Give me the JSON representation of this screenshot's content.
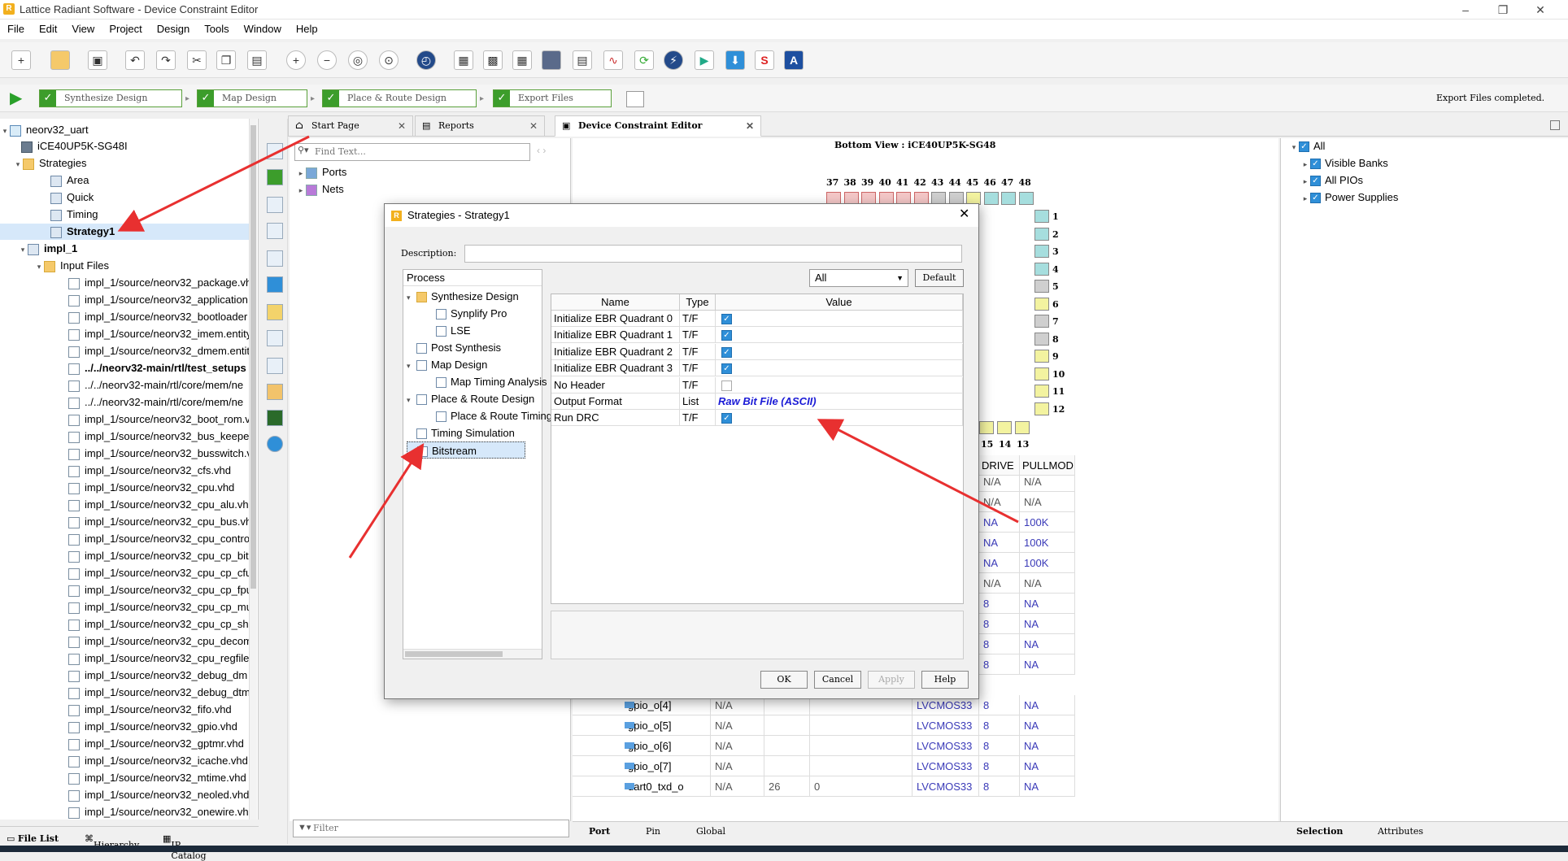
{
  "window": {
    "title": "Lattice Radiant Software - Device Constraint Editor",
    "minimize": "–",
    "maximize": "❐",
    "close": "✕"
  },
  "menu": [
    "File",
    "Edit",
    "View",
    "Project",
    "Design",
    "Tools",
    "Window",
    "Help"
  ],
  "flow": {
    "steps": [
      "Synthesize Design",
      "Map Design",
      "Place & Route Design",
      "Export Files"
    ],
    "status": "Export Files completed."
  },
  "project_tree": {
    "project": "neorv32_uart",
    "device": "iCE40UP5K-SG48I",
    "strategies_label": "Strategies",
    "strategies": [
      "Area",
      "Quick",
      "Timing",
      "Strategy1"
    ],
    "impl": "impl_1",
    "input_files_label": "Input Files",
    "files": [
      "impl_1/source/neorv32_package.vhd",
      "impl_1/source/neorv32_application",
      "impl_1/source/neorv32_bootloader",
      "impl_1/source/neorv32_imem.entity",
      "impl_1/source/neorv32_dmem.entity",
      "../../neorv32-main/rtl/test_setups",
      "../../neorv32-main/rtl/core/mem/ne",
      "../../neorv32-main/rtl/core/mem/ne",
      "impl_1/source/neorv32_boot_rom.vhd",
      "impl_1/source/neorv32_bus_keeper",
      "impl_1/source/neorv32_busswitch.vhd",
      "impl_1/source/neorv32_cfs.vhd",
      "impl_1/source/neorv32_cpu.vhd",
      "impl_1/source/neorv32_cpu_alu.vhd",
      "impl_1/source/neorv32_cpu_bus.vhd",
      "impl_1/source/neorv32_cpu_control",
      "impl_1/source/neorv32_cpu_cp_bitm",
      "impl_1/source/neorv32_cpu_cp_cfu",
      "impl_1/source/neorv32_cpu_cp_fpu",
      "impl_1/source/neorv32_cpu_cp_mul",
      "impl_1/source/neorv32_cpu_cp_shi",
      "impl_1/source/neorv32_cpu_decom",
      "impl_1/source/neorv32_cpu_regfile",
      "impl_1/source/neorv32_debug_dm",
      "impl_1/source/neorv32_debug_dtm",
      "impl_1/source/neorv32_fifo.vhd",
      "impl_1/source/neorv32_gpio.vhd",
      "impl_1/source/neorv32_gptmr.vhd",
      "impl_1/source/neorv32_icache.vhd",
      "impl_1/source/neorv32_mtime.vhd",
      "impl_1/source/neorv32_neoled.vhd",
      "impl_1/source/neorv32_onewire.vhd"
    ]
  },
  "left_tabs": [
    "File List",
    "Hierarchy",
    "IP Catalog"
  ],
  "doc_tabs": [
    "Start Page",
    "Reports",
    "Device Constraint Editor"
  ],
  "filter_panel": {
    "find_placeholder": "Find Text...",
    "items": [
      "Ports",
      "Nets"
    ],
    "filter_placeholder": "Filter"
  },
  "package_view": {
    "title": "Bottom View : iCE40UP5K-SG48",
    "top_pins": [
      "37",
      "38",
      "39",
      "40",
      "41",
      "42",
      "43",
      "44",
      "45",
      "46",
      "47",
      "48"
    ],
    "right_pins": [
      "1",
      "2",
      "3",
      "4",
      "5",
      "6",
      "7",
      "8",
      "9",
      "10",
      "11",
      "12"
    ],
    "bottom_pins": [
      "15",
      "14",
      "13"
    ]
  },
  "port_table": {
    "headers": [
      "DRIVE",
      "PULLMOD"
    ],
    "drive_pull": [
      [
        "N/A",
        "N/A"
      ],
      [
        "N/A",
        "N/A"
      ],
      [
        "NA",
        "100K"
      ],
      [
        "NA",
        "100K"
      ],
      [
        "NA",
        "100K"
      ],
      [
        "N/A",
        "N/A"
      ],
      [
        "8",
        "NA"
      ],
      [
        "8",
        "NA"
      ],
      [
        "8",
        "NA"
      ],
      [
        "8",
        "NA"
      ]
    ],
    "rows": [
      {
        "name": "gpio_o[4]",
        "c1": "N/A",
        "c2": "",
        "c3": "",
        "io": "LVCMOS33",
        "drive": "8",
        "pull": "NA"
      },
      {
        "name": "gpio_o[5]",
        "c1": "N/A",
        "c2": "",
        "c3": "",
        "io": "LVCMOS33",
        "drive": "8",
        "pull": "NA"
      },
      {
        "name": "gpio_o[6]",
        "c1": "N/A",
        "c2": "",
        "c3": "",
        "io": "LVCMOS33",
        "drive": "8",
        "pull": "NA"
      },
      {
        "name": "gpio_o[7]",
        "c1": "N/A",
        "c2": "",
        "c3": "",
        "io": "LVCMOS33",
        "drive": "8",
        "pull": "NA"
      },
      {
        "name": "uart0_txd_o",
        "c1": "N/A",
        "c2": "26",
        "c3": "0",
        "io": "LVCMOS33",
        "drive": "8",
        "pull": "NA"
      }
    ]
  },
  "bottom_tabs": [
    "Port",
    "Pin",
    "Global"
  ],
  "right_panel": {
    "items": [
      "All",
      "Visible Banks",
      "All PIOs",
      "Power Supplies"
    ],
    "tabs": [
      "Selection",
      "Attributes"
    ]
  },
  "dialog": {
    "title": "Strategies - Strategy1",
    "description_label": "Description:",
    "process_header": "Process",
    "process_tree": [
      {
        "label": "Synthesize Design",
        "level": 0,
        "folder": true
      },
      {
        "label": "Synplify Pro",
        "level": 1
      },
      {
        "label": "LSE",
        "level": 1
      },
      {
        "label": "Post Synthesis",
        "level": 0
      },
      {
        "label": "Map Design",
        "level": 0
      },
      {
        "label": "Map Timing Analysis",
        "level": 1
      },
      {
        "label": "Place & Route Design",
        "level": 0
      },
      {
        "label": "Place & Route Timing",
        "level": 1
      },
      {
        "label": "Timing Simulation",
        "level": 0
      },
      {
        "label": "Bitstream",
        "level": 0
      }
    ],
    "filter_value": "All",
    "default_button": "Default",
    "grid_headers": [
      "Name",
      "Type",
      "Value"
    ],
    "options": [
      {
        "name": "Initialize EBR Quadrant 0",
        "type": "T/F",
        "checked": true
      },
      {
        "name": "Initialize EBR Quadrant 1",
        "type": "T/F",
        "checked": true
      },
      {
        "name": "Initialize EBR Quadrant 2",
        "type": "T/F",
        "checked": true
      },
      {
        "name": "Initialize EBR Quadrant 3",
        "type": "T/F",
        "checked": true
      },
      {
        "name": "No Header",
        "type": "T/F",
        "checked": false
      },
      {
        "name": "Output Format",
        "type": "List",
        "value": "Raw Bit File (ASCII)"
      },
      {
        "name": "Run DRC",
        "type": "T/F",
        "checked": true
      }
    ],
    "buttons": {
      "ok": "OK",
      "cancel": "Cancel",
      "apply": "Apply",
      "help": "Help"
    }
  },
  "colors": {
    "accent": "#2f8fd8",
    "flow_green": "#3c9d2b",
    "annotation_red": "#e83030",
    "link_blue": "#1a1ad6"
  }
}
